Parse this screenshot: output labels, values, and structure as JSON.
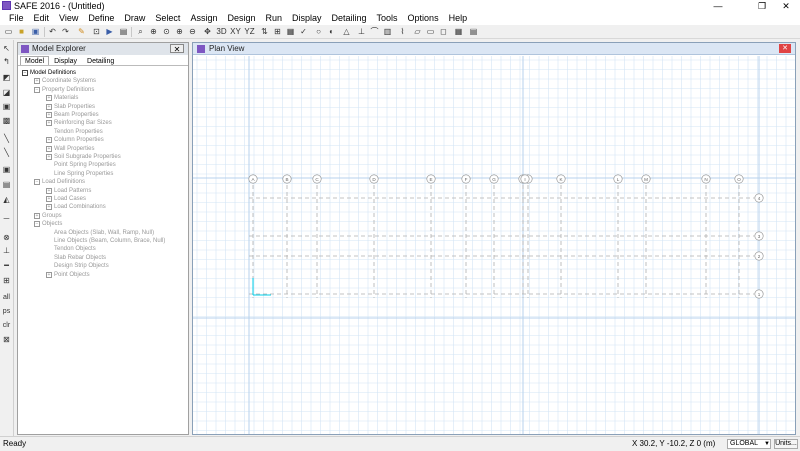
{
  "window": {
    "title": "SAFE 2016 - (Untitled)",
    "minimize": "—",
    "maximize": "❐",
    "close": "✕"
  },
  "menu": [
    "File",
    "Edit",
    "View",
    "Define",
    "Draw",
    "Select",
    "Assign",
    "Design",
    "Run",
    "Display",
    "Detailing",
    "Tools",
    "Options",
    "Help"
  ],
  "toolbar": {
    "view_labels": [
      "3D",
      "XY",
      "YZ"
    ]
  },
  "left_toolstrip": {
    "all": "all",
    "ps": "ps",
    "clr": "clr"
  },
  "explorer": {
    "title": "Model Explorer",
    "close": "✕",
    "tabs": [
      "Model",
      "Display",
      "Detailing"
    ],
    "active_tab": "Model",
    "tree": [
      {
        "label": "Model Definitions",
        "level": 0,
        "toggle": "−",
        "root": true
      },
      {
        "label": "Coordinate Systems",
        "level": 1,
        "toggle": "+"
      },
      {
        "label": "Property Definitions",
        "level": 1,
        "toggle": "−"
      },
      {
        "label": "Materials",
        "level": 2,
        "toggle": "+"
      },
      {
        "label": "Slab Properties",
        "level": 2,
        "toggle": "+"
      },
      {
        "label": "Beam Properties",
        "level": 2,
        "toggle": "+"
      },
      {
        "label": "Reinforcing Bar Sizes",
        "level": 2,
        "toggle": "+"
      },
      {
        "label": "Tendon Properties",
        "level": 2,
        "toggle": ""
      },
      {
        "label": "Column Properties",
        "level": 2,
        "toggle": "+"
      },
      {
        "label": "Wall Properties",
        "level": 2,
        "toggle": "+"
      },
      {
        "label": "Soil Subgrade Properties",
        "level": 2,
        "toggle": "+"
      },
      {
        "label": "Point Spring Properties",
        "level": 2,
        "toggle": ""
      },
      {
        "label": "Line Spring Properties",
        "level": 2,
        "toggle": ""
      },
      {
        "label": "Load Definitions",
        "level": 1,
        "toggle": "−"
      },
      {
        "label": "Load Patterns",
        "level": 2,
        "toggle": "+"
      },
      {
        "label": "Load Cases",
        "level": 2,
        "toggle": "+"
      },
      {
        "label": "Load Combinations",
        "level": 2,
        "toggle": "+"
      },
      {
        "label": "Groups",
        "level": 1,
        "toggle": "+"
      },
      {
        "label": "Objects",
        "level": 1,
        "toggle": "−"
      },
      {
        "label": "Area Objects (Slab, Wall, Ramp, Null)",
        "level": 2,
        "toggle": ""
      },
      {
        "label": "Line Objects (Beam, Column, Brace, Null)",
        "level": 2,
        "toggle": ""
      },
      {
        "label": "Tendon Objects",
        "level": 2,
        "toggle": ""
      },
      {
        "label": "Slab Rebar Objects",
        "level": 2,
        "toggle": ""
      },
      {
        "label": "Design Strip Objects",
        "level": 2,
        "toggle": ""
      },
      {
        "label": "Point Objects",
        "level": 2,
        "toggle": "+"
      }
    ]
  },
  "plan_view": {
    "title": "Plan View",
    "close": "✕",
    "grid_x_labels": [
      "A",
      "B",
      "C",
      "D",
      "E",
      "F",
      "G",
      "H",
      "I",
      "J",
      "K",
      "L",
      "M",
      "N",
      "O"
    ],
    "grid_y_labels": [
      "1",
      "2",
      "3",
      "4"
    ],
    "colors": {
      "minor_grid": "#d4e5f5",
      "major_grid": "#b7d2ec",
      "grid_line": "#b0b0b0",
      "axis": "#00cfe8"
    }
  },
  "status": {
    "left": "Ready",
    "coordinates": "X 30.2,  Y -10.2,  Z 0   (m)",
    "coord_system": "GLOBAL",
    "units_button": "Units..."
  }
}
